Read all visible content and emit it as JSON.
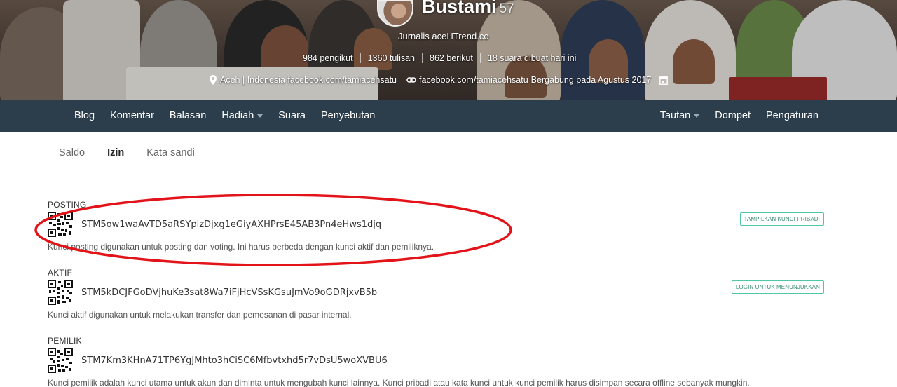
{
  "profile": {
    "name": "Bustami",
    "reputation": "57",
    "about": "Jurnalis aceHTrend.co",
    "stats": [
      {
        "label": "984 pengikut"
      },
      {
        "label": "1360 tulisan"
      },
      {
        "label": "862 berikut"
      },
      {
        "label": "18 suara dibuat hari ini"
      }
    ],
    "location": "Aceh | Indonesia facebook.com/tamiacehsatu",
    "website": "facebook.com/tamiacehsatu",
    "joined": "Bergabung pada Agustus 2017"
  },
  "nav": {
    "left": [
      {
        "label": "Blog"
      },
      {
        "label": "Komentar"
      },
      {
        "label": "Balasan"
      },
      {
        "label": "Hadiah",
        "dropdown": true
      },
      {
        "label": "Suara"
      },
      {
        "label": "Penyebutan"
      }
    ],
    "right": [
      {
        "label": "Tautan",
        "dropdown": true
      },
      {
        "label": "Dompet"
      },
      {
        "label": "Pengaturan"
      }
    ]
  },
  "subtabs": [
    {
      "label": "Saldo",
      "active": false
    },
    {
      "label": "Izin",
      "active": true
    },
    {
      "label": "Kata sandi",
      "active": false
    }
  ],
  "keys": {
    "posting": {
      "title": "POSTING",
      "value": "STM5ow1waAvTD5aRSYpizDjxg1eGiyAXHPrsE45AB3Pn4eHws1djq",
      "description": "Kunci posting digunakan untuk posting dan voting. Ini harus berbeda dengan kunci aktif dan pemiliknya.",
      "button": "TAMPILKAN KUNCI PRIBADI"
    },
    "active": {
      "title": "AKTIF",
      "value": "STM5kDCJFGoDVjhuKe3sat8Wa7iFjHcVSsKGsuJmVo9oGDRjxvB5b",
      "description": "Kunci aktif digunakan untuk melakukan transfer dan pemesanan di pasar internal.",
      "button": "LOGIN UNTUK MENUNJUKKAN"
    },
    "owner": {
      "title": "PEMILIK",
      "value": "STM7Km3KHnA71TP6YgJMhto3hCiSC6Mfbvtxhd5r7vDsU5woXVBU6",
      "description": "Kunci pemilik adalah kunci utama untuk akun dan diminta untuk mengubah kunci lainnya. Kunci pribadi atau kata kunci untuk kunci pemilik harus disimpan secara offline sebanyak mungkin."
    }
  },
  "colors": {
    "navbar": "#2c3e4c",
    "accent": "#4fc6a5",
    "annotation": "#e2141a"
  }
}
